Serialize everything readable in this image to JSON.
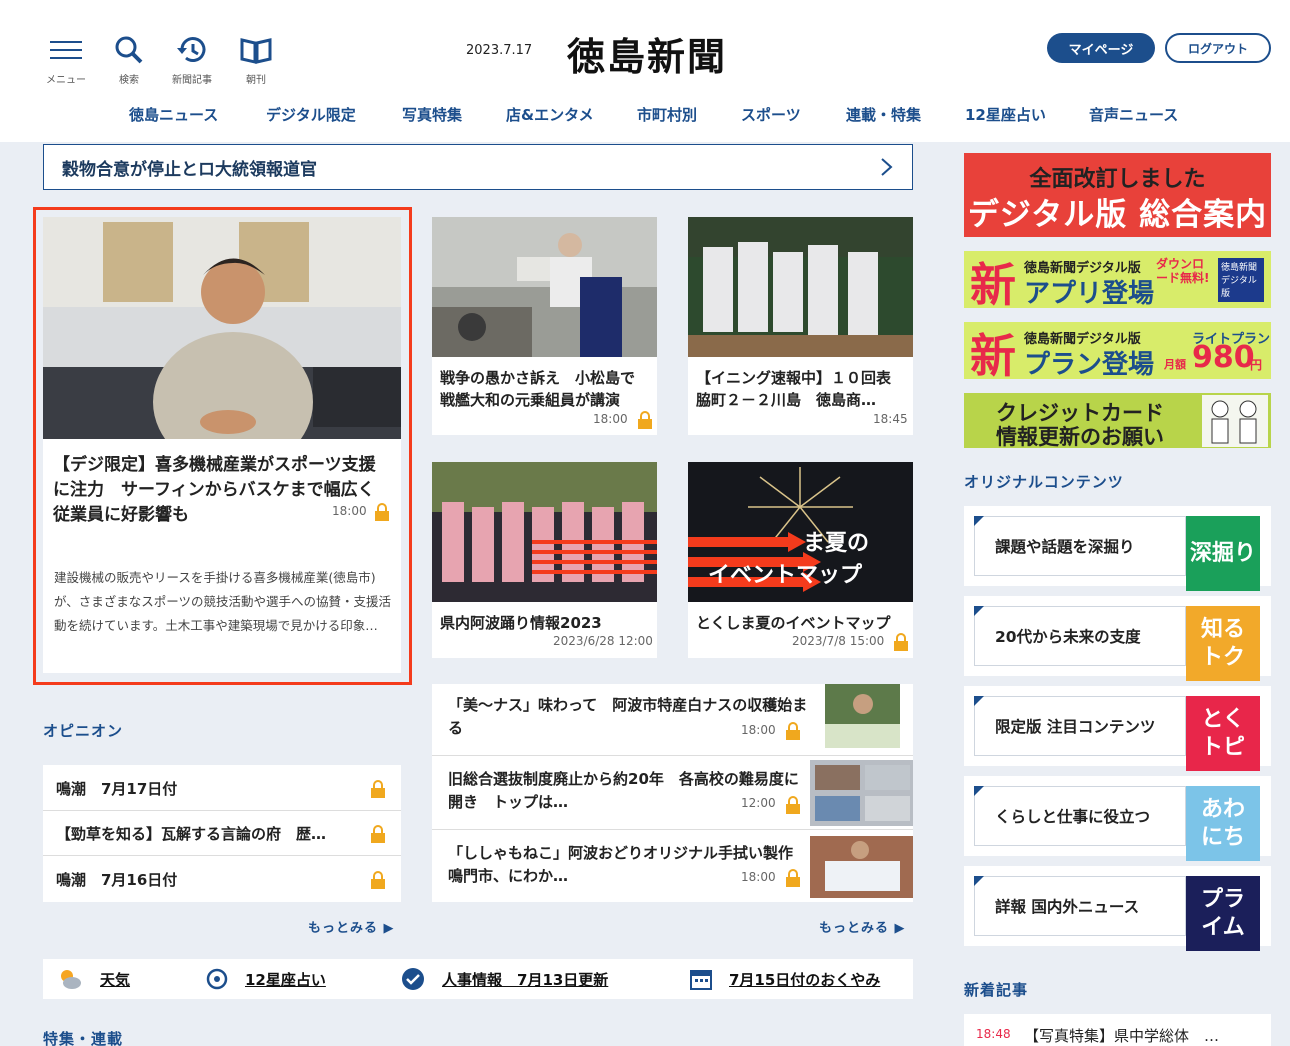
{
  "header": {
    "icons": [
      {
        "name": "menu",
        "label": "メニュー"
      },
      {
        "name": "search",
        "label": "検索"
      },
      {
        "name": "history",
        "label": "新聞記事"
      },
      {
        "name": "book",
        "label": "朝刊"
      }
    ],
    "date": "2023.7.17",
    "logo": "徳島新聞",
    "mypage": "マイページ",
    "logout": "ログアウト"
  },
  "nav": [
    "徳島ニュース",
    "デジタル限定",
    "写真特集",
    "店&エンタメ",
    "市町村別",
    "スポーツ",
    "連載・特集",
    "12星座占い",
    "音声ニュース"
  ],
  "ticker": "穀物合意が停止とロ大統領報道官",
  "feature": {
    "title": "【デジ限定】喜多機械産業がスポーツ支援に注力　サーフィンからバスケまで幅広く　従業員に好影響も",
    "time": "18:00",
    "desc": "建設機械の販売やリースを手掛ける喜多機械産業(徳島市)が、さまざまなスポーツの競技活動や選手への協賛・支援活動を続けています。土木工事や建築現場で見かける印象…"
  },
  "cards": [
    {
      "title": "戦争の愚かさ訴え　小松島で戦艦大和の元乗組員が講演",
      "time": "18:00"
    },
    {
      "title": "【イニング速報中】１０回表　脇町２－２川島　徳島商…",
      "time": "18:45"
    },
    {
      "title": "県内阿波踊り情報2023",
      "time": "2023/6/28 12:00"
    },
    {
      "title": "とくしま夏のイベントマップ",
      "time": "2023/7/8 15:00",
      "overlay": "ま夏の\nイベントマップ"
    }
  ],
  "opinion": {
    "title": "オピニオン",
    "items": [
      "鳴潮　7月17日付",
      "【勁草を知る】瓦解する言論の府　歴…",
      "鳴潮　7月16日付"
    ],
    "more": "もっとみる"
  },
  "list": {
    "items": [
      {
        "title": "「美～ナス」味わって　阿波市特産白ナスの収穫始まる",
        "time": "18:00"
      },
      {
        "title": "旧総合選抜制度廃止から約20年　各高校の難易度に開き　トップは…",
        "time": "12:00"
      },
      {
        "title": "「ししゃもねこ」阿波おどりオリジナル手拭い製作　鳴門市、にわか…",
        "time": "18:00"
      }
    ],
    "more": "もっとみる"
  },
  "quick": [
    {
      "icon": "weather-icon",
      "label": "天気"
    },
    {
      "icon": "horoscope-icon",
      "label": "12星座占い"
    },
    {
      "icon": "check-icon",
      "label": "人事情報　7月13日更新"
    },
    {
      "icon": "calendar-icon",
      "label": "7月15日付のおくやみ"
    }
  ],
  "series_title": "特集・連載",
  "right": {
    "banner1": {
      "line1": "全面改訂しました",
      "line2": "デジタル版 総合案内"
    },
    "banner2": {
      "big": "新",
      "small": "徳島新聞デジタル版",
      "main": "アプリ登場",
      "side": "ダウンロード無料!",
      "badge": "徳島新聞デジタル版"
    },
    "banner3": {
      "big": "新",
      "small": "徳島新聞デジタル版",
      "main": "プラン登場",
      "side": "ライトプラン",
      "price": "980",
      "unit": "円",
      "per": "月額"
    },
    "banner4": {
      "line1": "クレジットカード",
      "line2": "情報更新のお願い"
    },
    "orig_title": "オリジナルコンテンツ",
    "orig": [
      {
        "text": "課題や話題を深掘り",
        "tag": "深掘り",
        "color": "#1aa05a"
      },
      {
        "text": "20代から未来の支度",
        "tag": "知る\nトク",
        "color": "#f2a92a"
      },
      {
        "text": "限定版 注目コンテンツ",
        "tag": "とく\nトピ",
        "color": "#e8264a"
      },
      {
        "text": "くらしと仕事に役立つ",
        "tag": "あわ\nにち",
        "color": "#7cc4e8"
      },
      {
        "text": "詳報 国内外ニュース",
        "tag": "プラ\nイム",
        "color": "#1b1f5a"
      }
    ],
    "new_title": "新着記事",
    "new_item": {
      "time": "18:48",
      "title": "【写真特集】県中学総体　…"
    }
  }
}
